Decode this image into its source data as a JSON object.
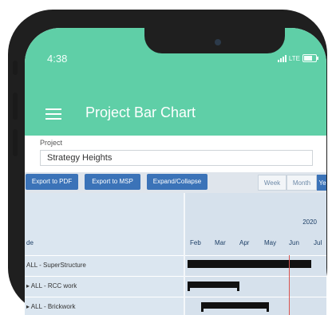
{
  "status_bar": {
    "time": "4:38",
    "network": "LTE"
  },
  "app_bar": {
    "title": "Project Bar Chart",
    "menu_icon": "hamburger-icon"
  },
  "project": {
    "label": "Project",
    "value": "Strategy Heights"
  },
  "toolbar": {
    "buttons": [
      "Export to PDF",
      "Export to MSP",
      "Expand/Collapse"
    ],
    "views": [
      "Week",
      "Month",
      "Ye"
    ],
    "active_view": "Ye",
    "accent_color": "#3b73b8"
  },
  "gantt": {
    "name_header": "de",
    "year": "2020",
    "months": [
      "Feb",
      "Mar",
      "Apr",
      "May",
      "Jun",
      "Jul"
    ],
    "rows": [
      {
        "label": "ALL - SuperStructure",
        "kind": "summary",
        "start_month": 0.0,
        "end_month": 5.0
      },
      {
        "label": "▸ ALL - RCC work",
        "kind": "task",
        "start_month": 0.0,
        "end_month": 2.1
      },
      {
        "label": "▸ ALL - Brickwork",
        "kind": "task",
        "start_month": 0.55,
        "end_month": 3.3
      }
    ],
    "today_month": 4.1,
    "today_color": "#d9534f"
  }
}
